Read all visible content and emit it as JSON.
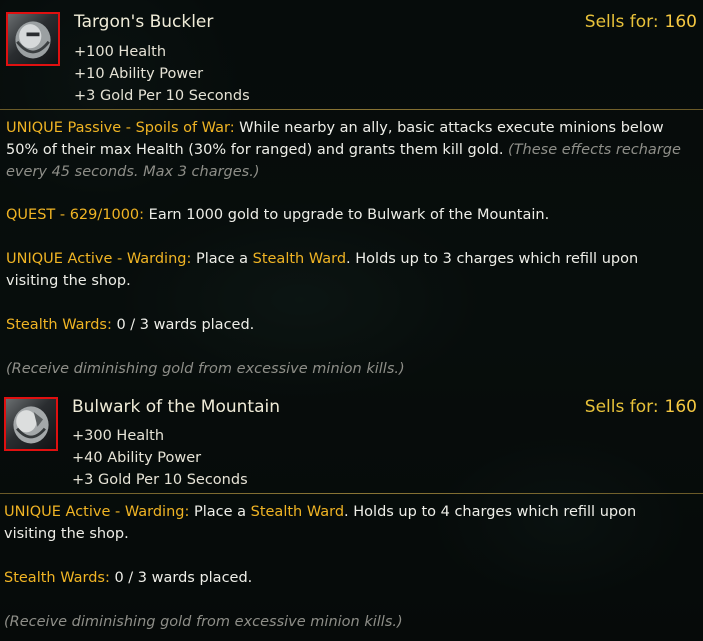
{
  "tooltips": [
    {
      "item_name": "Targon's Buckler",
      "sells_label": "Sells for:",
      "sells_value": "160",
      "stats": [
        "+100 Health",
        "+10 Ability Power",
        "+3 Gold Per 10 Seconds"
      ],
      "passive_title": "UNIQUE Passive - Spoils of War:",
      "passive_text_1": " While nearby an ally, basic attacks execute minions below",
      "passive_text_2": "50% of their max Health (30% for ranged) and grants them kill gold. ",
      "passive_note_1": "(These effects recharge",
      "passive_note_2": "every 45 seconds. Max 3 charges.)",
      "quest_title": "QUEST - 629/1000:",
      "quest_text": " Earn 1000 gold to upgrade to Bulwark of the Mountain.",
      "active_title": "UNIQUE Active - Warding:",
      "active_pre": " Place a ",
      "active_ward": "Stealth Ward",
      "active_post": ".  Holds up to 3 charges which refill upon",
      "active_line2": "visiting the shop.",
      "wards_label": "Stealth Wards:",
      "wards_text": " 0 / 3 wards placed.",
      "footer": "(Receive diminishing gold from excessive minion kills.)"
    },
    {
      "item_name": "Bulwark of the Mountain",
      "sells_label": "Sells for:",
      "sells_value": "160",
      "stats": [
        "+300 Health",
        "+40 Ability Power",
        "+3 Gold Per 10 Seconds"
      ],
      "active_title": "UNIQUE Active - Warding:",
      "active_pre": " Place a ",
      "active_ward": "Stealth Ward",
      "active_post": ".  Holds up to 4 charges which refill upon",
      "active_line2": "visiting the shop.",
      "wards_label": "Stealth Wards:",
      "wards_text": " 0 / 3 wards placed.",
      "footer": "(Receive diminishing gold from excessive minion kills.)"
    }
  ],
  "colors": {
    "gold_keyword": "#f0b424",
    "sells_gold": "#e8c23a",
    "icon_border": "#e01010",
    "note_grey": "#8e8e88",
    "divider": "#8a7535"
  },
  "icons": [
    "targons-buckler-icon",
    "bulwark-of-the-mountain-icon"
  ]
}
